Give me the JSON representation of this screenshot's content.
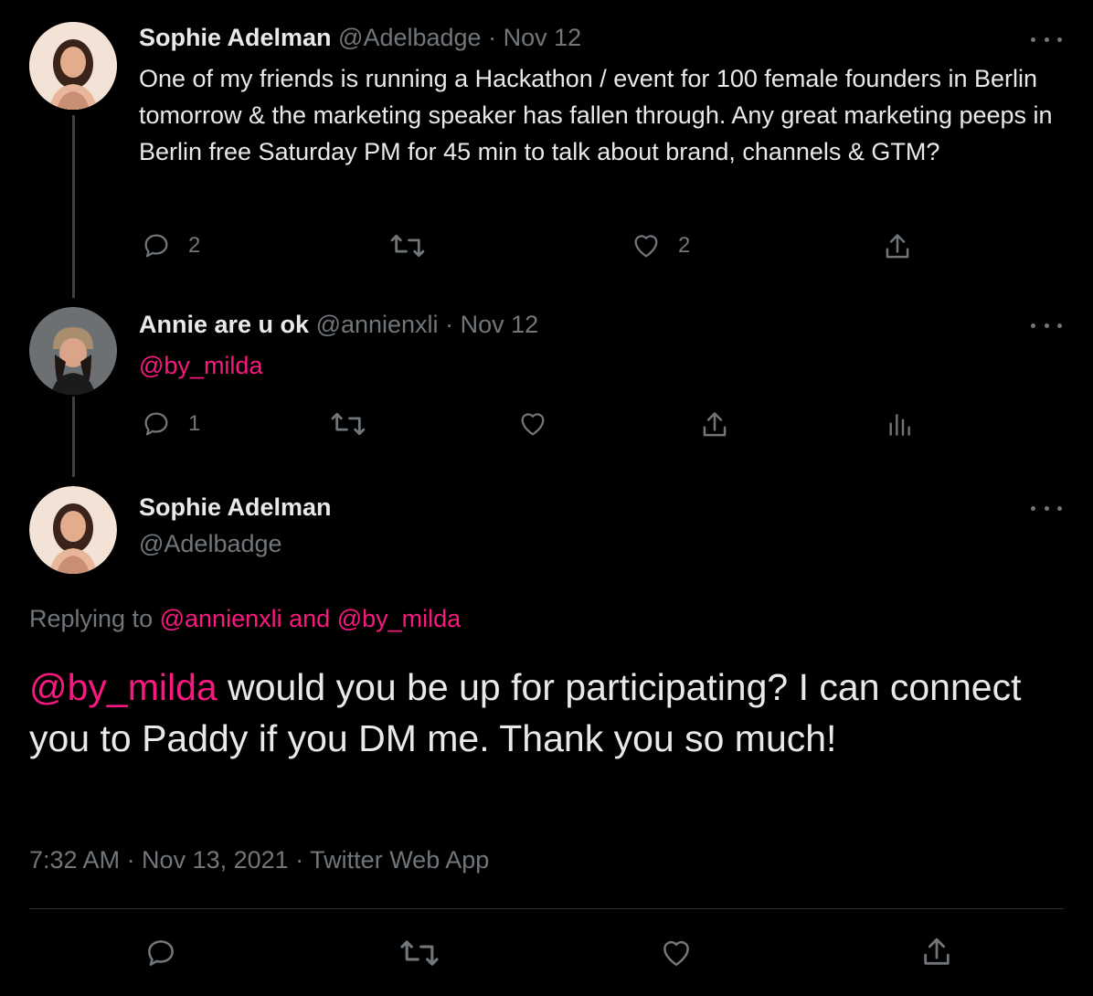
{
  "tweets": [
    {
      "name": "Sophie Adelman",
      "handle": "@Adelbadge",
      "date": "· Nov 12",
      "text": "One of my friends is running a Hackathon / event for 100 female founders in Berlin tomorrow & the marketing speaker has fallen through. Any great marketing peeps in Berlin free Saturday PM for 45 min to talk about brand, channels & GTM?",
      "reply_count": "2",
      "retweet_count": "",
      "like_count": "2"
    },
    {
      "name": "Annie are u ok",
      "handle": "@annienxli",
      "date": "· Nov 12",
      "text": "@by_milda",
      "reply_count": "1",
      "retweet_count": "",
      "like_count": ""
    }
  ],
  "main_tweet": {
    "name": "Sophie Adelman",
    "handle": "@Adelbadge",
    "replying_prefix": "Replying to",
    "replying_to_1": "@annienxli",
    "replying_and": "and",
    "replying_to_2": "@by_milda",
    "mention": "@by_milda",
    "text_rest": " would you be up for participating? I can connect you to Paddy if you DM me. Thank you so much!",
    "timestamp": "7:32 AM · Nov 13, 2021 · Twitter Web App"
  },
  "colors": {
    "background": "#000000",
    "text": "#e7e9ea",
    "muted": "#71767b",
    "mention": "#f91880"
  },
  "icons": [
    "reply-icon",
    "retweet-icon",
    "like-icon",
    "share-icon",
    "analytics-icon",
    "more-icon"
  ]
}
